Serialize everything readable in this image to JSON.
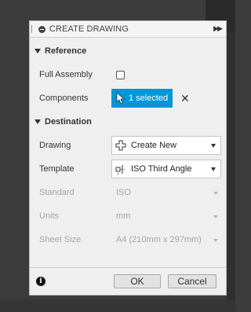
{
  "dialog": {
    "title": "CREATE DRAWING"
  },
  "reference": {
    "header": "Reference",
    "full_assembly_label": "Full Assembly",
    "components_label": "Components",
    "components_value": "1 selected"
  },
  "destination": {
    "header": "Destination",
    "drawing_label": "Drawing",
    "drawing_value": "Create New",
    "template_label": "Template",
    "template_value": "ISO Third Angle",
    "standard_label": "Standard",
    "standard_value": "ISO",
    "units_label": "Units",
    "units_value": "mm",
    "sheet_size_label": "Sheet Size",
    "sheet_size_value": "A4 (210mm x 297mm)"
  },
  "footer": {
    "ok_label": "OK",
    "cancel_label": "Cancel"
  },
  "colors": {
    "accent": "#0696d7",
    "disabled_text": "#a5a5a5"
  }
}
